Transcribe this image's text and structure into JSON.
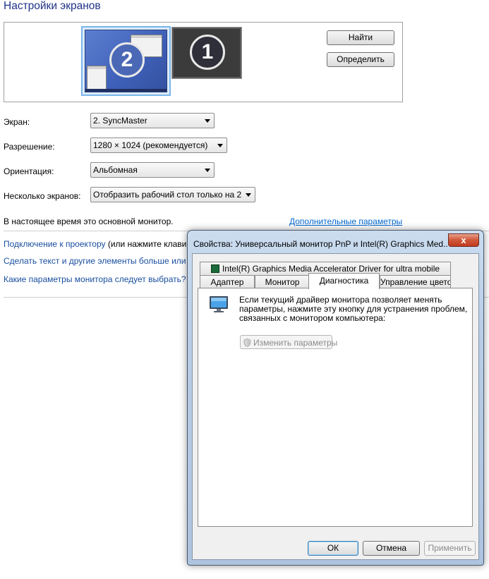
{
  "page": {
    "title": "Настройки экранов"
  },
  "monitors": {
    "selected_number": "2",
    "other_number": "1",
    "find_label": "Найти",
    "identify_label": "Определить"
  },
  "fields": {
    "screen_label": "Экран:",
    "screen_value": "2. SyncMaster",
    "resolution_label": "Разрешение:",
    "resolution_value": "1280 × 1024 (рекомендуется)",
    "orientation_label": "Ориентация:",
    "orientation_value": "Альбомная",
    "multi_label": "Несколько экранов:",
    "multi_value": "Отобразить рабочий стол только на 2"
  },
  "status": {
    "text": "В настоящее время это основной монитор.",
    "advanced_link": "Дополнительные параметры"
  },
  "links": {
    "projector": "Подключение к проектору",
    "projector_suffix": " (или нажмите клави",
    "text_size": "Сделать текст и другие элементы больше или м",
    "which_params": "Какие параметры монитора следует выбрать?"
  },
  "dialog": {
    "title": "Свойства: Универсальный монитор PnP и Intel(R) Graphics Med...",
    "close_glyph": "x",
    "tabs": {
      "intel": "Intel(R) Graphics Media Accelerator Driver for ultra mobile",
      "adapter": "Адаптер",
      "monitor": "Монитор",
      "diagnostics": "Диагностика",
      "color": "Управление цветом"
    },
    "diagnostics_text": "Если текущий драйвер монитора позволяет менять параметры, нажмите эту кнопку для устранения проблем, связанных с монитором компьютера:",
    "change_button": "Изменить параметры",
    "ok": "ОК",
    "cancel": "Отмена",
    "apply": "Применить"
  },
  "colors": {
    "title_blue": "#1e3287",
    "link_blue": "#1a4fa0",
    "close_red": "#c13a1c"
  }
}
